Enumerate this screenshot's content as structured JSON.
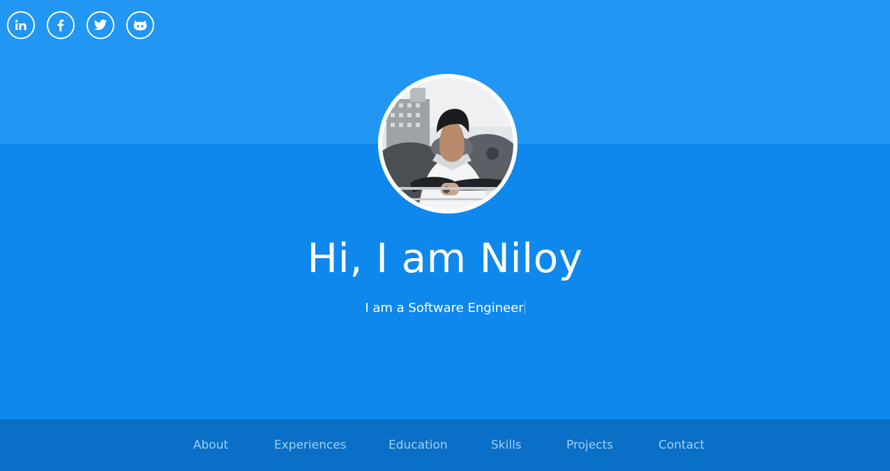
{
  "social": [
    {
      "icon": "linkedin-icon",
      "label": "in"
    },
    {
      "icon": "facebook-icon",
      "label": "f"
    },
    {
      "icon": "twitter-icon"
    },
    {
      "icon": "github-icon"
    }
  ],
  "hero": {
    "title": "Hi, I am Niloy",
    "subtitle": "I am a Software Engineer"
  },
  "nav": {
    "items": [
      {
        "label": "About"
      },
      {
        "label": "Experiences"
      },
      {
        "label": "Education"
      },
      {
        "label": "Skills"
      },
      {
        "label": "Projects"
      },
      {
        "label": "Contact"
      }
    ]
  },
  "colors": {
    "top_band": "#2196f3",
    "main_background": "#0e88ec",
    "bottom_nav": "#0a6fc6",
    "nav_text": "#9fd0f7",
    "text": "#ffffff"
  }
}
